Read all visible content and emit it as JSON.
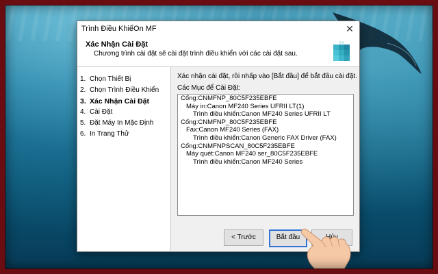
{
  "dialog": {
    "title": "Trình Điều KhiểOn MF",
    "header_title": "Xác Nhận Cài Đặt",
    "header_subtitle": "Chương trình cài đặt sẽ cài đặt trình điều khiển với các cài đặt sau.",
    "close_icon": "close-icon"
  },
  "steps": [
    {
      "num": "1.",
      "label": "Chọn Thiết Bị"
    },
    {
      "num": "2.",
      "label": "Chọn Trình Điều Khiển"
    },
    {
      "num": "3.",
      "label": "Xác Nhận Cài Đặt"
    },
    {
      "num": "4.",
      "label": "Cài Đặt"
    },
    {
      "num": "5.",
      "label": "Đặt Máy In Mặc Định"
    },
    {
      "num": "6.",
      "label": "In Trang Thử"
    }
  ],
  "active_step": 3,
  "main": {
    "instruction": "Xác nhận cài đặt, rồi nhấp vào [Bắt đầu] để bắt đầu cài đặt.",
    "list_label": "Các Mục để Cài Đặt:",
    "items": [
      {
        "level": 0,
        "text": "Cổng:CNMFNP_80C5F235EBFE"
      },
      {
        "level": 1,
        "text": "Máy in:Canon MF240 Series UFRII LT(1)"
      },
      {
        "level": 2,
        "text": "Trình điều khiển:Canon MF240 Series UFRII LT"
      },
      {
        "level": 0,
        "text": "Cổng:CNMFNP_80C5F235EBFE"
      },
      {
        "level": 1,
        "text": "Fax:Canon MF240 Series (FAX)"
      },
      {
        "level": 2,
        "text": "Trình điều khiển:Canon Generic FAX Driver (FAX)"
      },
      {
        "level": 0,
        "text": "Cổng:CNMFNPSCAN_80C5F235EBFE"
      },
      {
        "level": 1,
        "text": "Máy quét:Canon MF240 ser_80C5F235EBFE"
      },
      {
        "level": 2,
        "text": "Trình điều khiển:Canon MF240 Series"
      }
    ]
  },
  "buttons": {
    "back": "< Trước",
    "start": "Bắt đầu",
    "cancel": "Hủy"
  },
  "colors": {
    "frame": "#6a0d12",
    "focus": "#3375d6"
  }
}
